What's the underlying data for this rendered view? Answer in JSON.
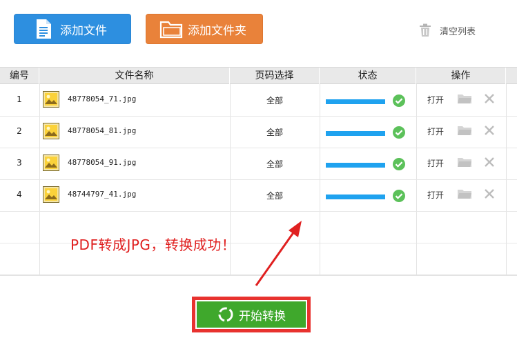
{
  "toolbar": {
    "add_file_label": "添加文件",
    "add_folder_label": "添加文件夹",
    "clear_list_label": "清空列表"
  },
  "table": {
    "headers": [
      "编号",
      "文件名称",
      "页码选择",
      "状态",
      "操作"
    ],
    "rows": [
      {
        "index": "1",
        "file_name": "48778054_71.jpg",
        "pages": "全部",
        "progress": 1.0,
        "action_open": "打开"
      },
      {
        "index": "2",
        "file_name": "48778054_81.jpg",
        "pages": "全部",
        "progress": 1.0,
        "action_open": "打开"
      },
      {
        "index": "3",
        "file_name": "48778054_91.jpg",
        "pages": "全部",
        "progress": 1.0,
        "action_open": "打开"
      },
      {
        "index": "4",
        "file_name": "48744797_41.jpg",
        "pages": "全部",
        "progress": 1.0,
        "action_open": "打开"
      }
    ]
  },
  "annotation": {
    "text": "PDF转成JPG，转换成功！",
    "color": "#e02020"
  },
  "start": {
    "label": "开始转换"
  },
  "colors": {
    "add_file_bg": "#2d8fe0",
    "add_folder_bg": "#e9823a",
    "progress": "#1fa2ef",
    "success": "#5cc15a",
    "start_bg": "#3fa82c",
    "highlight": "#e8322f"
  },
  "icons": {
    "add_file": "document-icon",
    "add_folder": "folder-icon",
    "clear": "trash-icon",
    "file": "image-file-icon",
    "status_ok": "check-circle-icon",
    "open_folder": "folder-open-icon",
    "remove": "close-icon",
    "start": "refresh-icon"
  }
}
